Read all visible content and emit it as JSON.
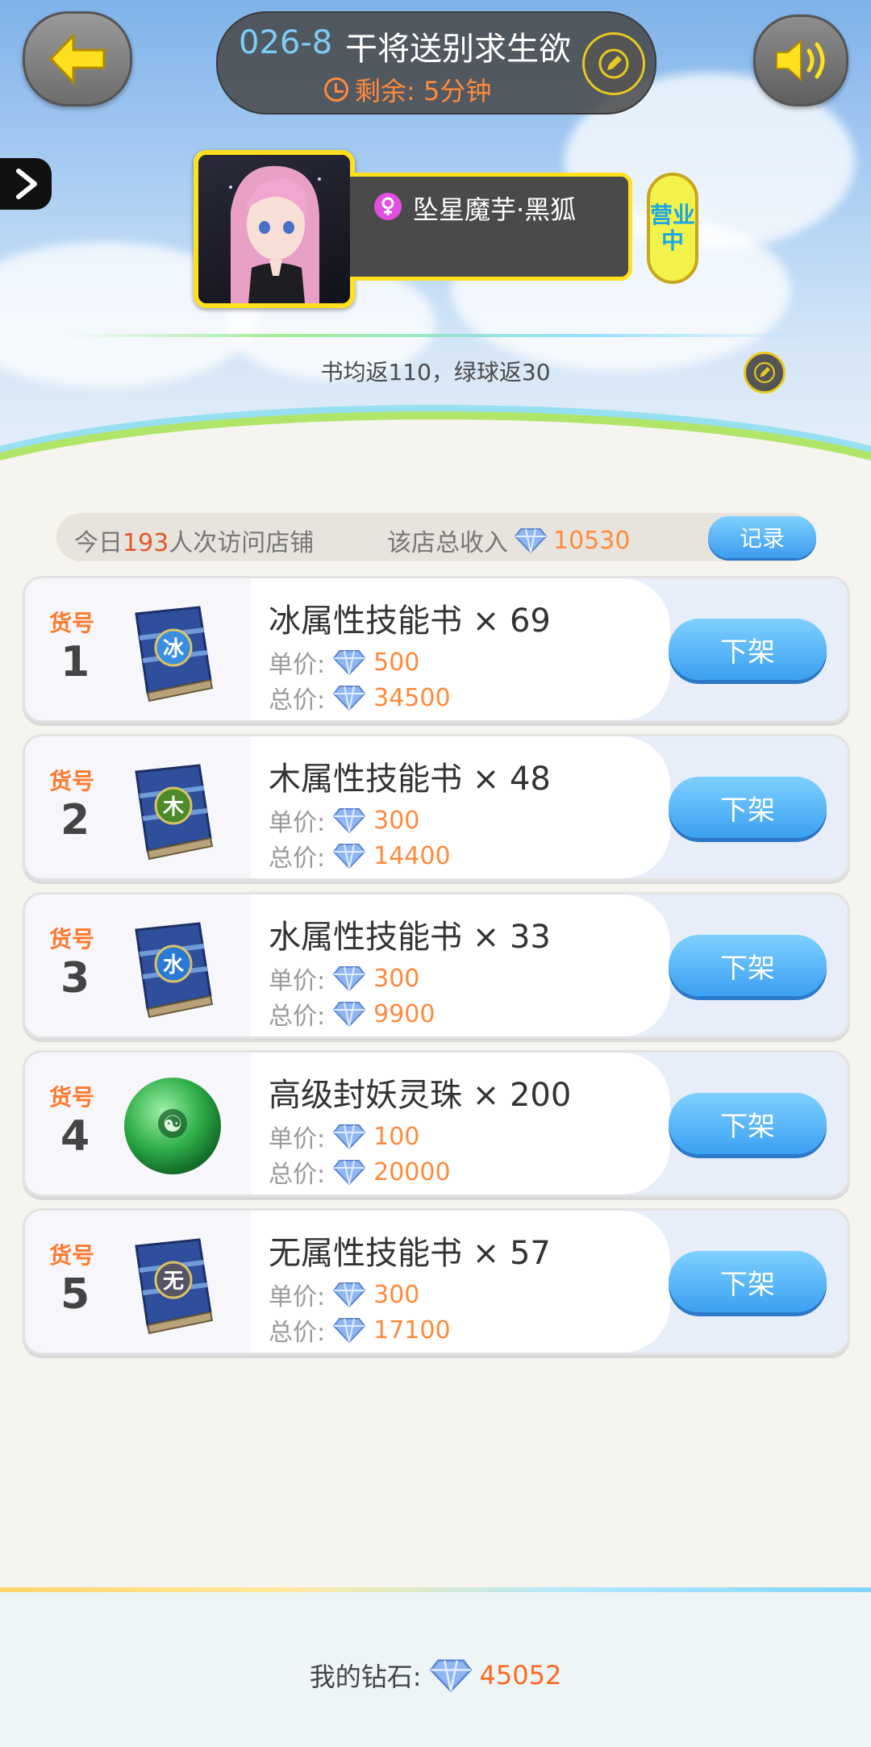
{
  "header": {
    "code": "026-8",
    "title": "干将送别求生欲",
    "time_left": "剩余: 5分钟"
  },
  "shop": {
    "owner_name": "坠星魔芋·黑狐",
    "status": [
      "营业",
      "中"
    ],
    "notice": "书均返110，绿球返30"
  },
  "stats": {
    "visit_prefix": "今日",
    "visit_count": "193",
    "visit_suffix": "人次访问店铺",
    "income_label": "该店总收入",
    "income_value": "10530",
    "record_button": "记录"
  },
  "labels": {
    "item_no": "货号",
    "unit_price": "单价:",
    "total_price": "总价:",
    "unlist_button": "下架"
  },
  "items": [
    {
      "no": "1",
      "name": "冰属性技能书 × 69",
      "unit": "500",
      "total": "34500",
      "icon": "ice-skill-book-icon",
      "glyph": "冰"
    },
    {
      "no": "2",
      "name": "木属性技能书 × 48",
      "unit": "300",
      "total": "14400",
      "icon": "wood-skill-book-icon",
      "glyph": "木"
    },
    {
      "no": "3",
      "name": "水属性技能书 × 33",
      "unit": "300",
      "total": "9900",
      "icon": "water-skill-book-icon",
      "glyph": "水"
    },
    {
      "no": "4",
      "name": "高级封妖灵珠 × 200",
      "unit": "100",
      "total": "20000",
      "icon": "green-spirit-orb-icon",
      "glyph": "☯"
    },
    {
      "no": "5",
      "name": "无属性技能书 × 57",
      "unit": "300",
      "total": "17100",
      "icon": "neutral-skill-book-icon",
      "glyph": "无"
    }
  ],
  "footer": {
    "label": "我的钻石:",
    "value": "45052"
  },
  "colors": {
    "accent_orange": "#ff8a3c",
    "button_blue": "#3aa0f2",
    "frame_yellow": "#ffe01e"
  }
}
